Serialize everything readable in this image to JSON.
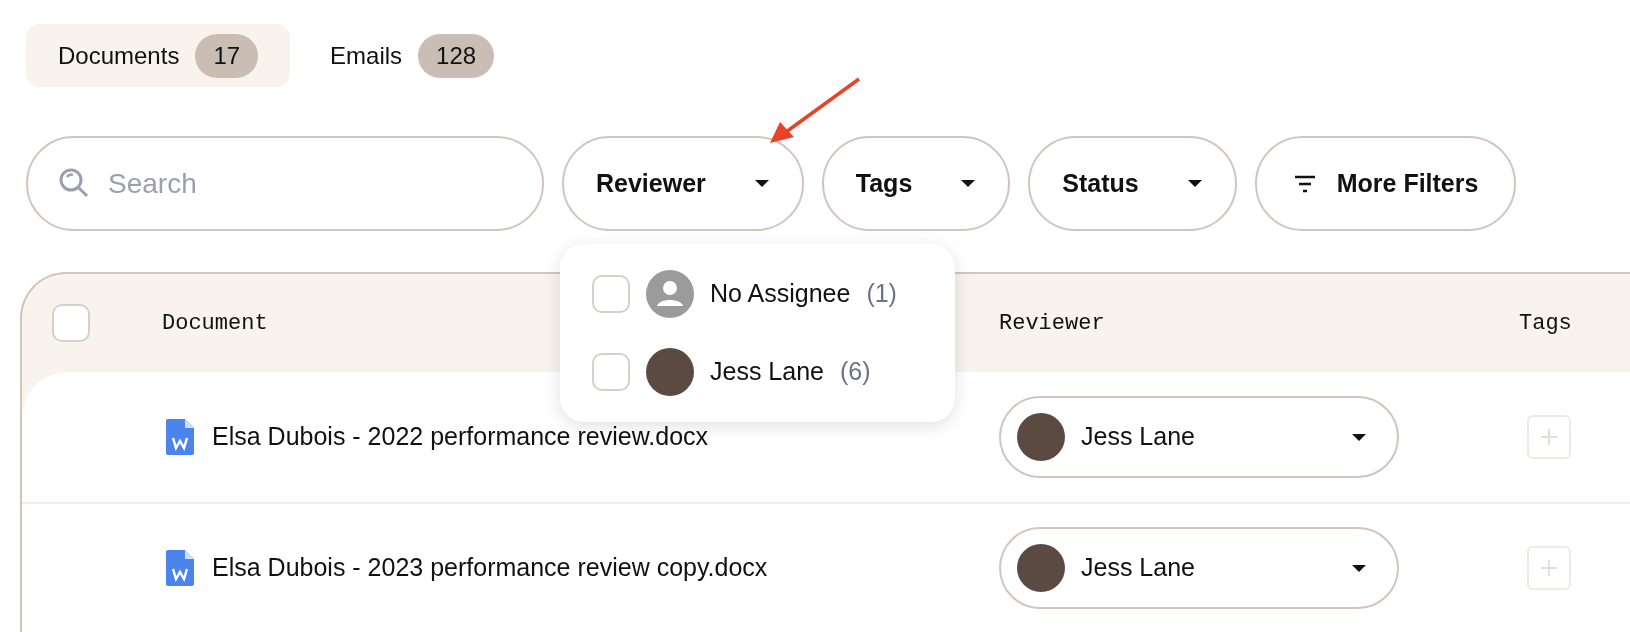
{
  "tabs": [
    {
      "label": "Documents",
      "count": "17",
      "selected": true
    },
    {
      "label": "Emails",
      "count": "128",
      "selected": false
    }
  ],
  "search": {
    "placeholder": "Search"
  },
  "filters": [
    {
      "label": "Reviewer",
      "kind": "dropdown"
    },
    {
      "label": "Tags",
      "kind": "dropdown"
    },
    {
      "label": "Status",
      "kind": "dropdown"
    },
    {
      "label": "More Filters",
      "kind": "more"
    }
  ],
  "reviewer_menu": {
    "options": [
      {
        "label": "No Assignee",
        "count": "(1)",
        "checked": false,
        "kind": "none"
      },
      {
        "label": "Jess Lane",
        "count": "(6)",
        "checked": false,
        "kind": "person"
      }
    ]
  },
  "table": {
    "select_all_checked": false,
    "columns": [
      "Document",
      "Reviewer",
      "Tags"
    ],
    "rows": [
      {
        "document": "Elsa Dubois - 2022 performance review.docx",
        "reviewer": "Jess Lane"
      },
      {
        "document": "Elsa Dubois - 2023 performance review copy.docx",
        "reviewer": "Jess Lane"
      }
    ]
  }
}
